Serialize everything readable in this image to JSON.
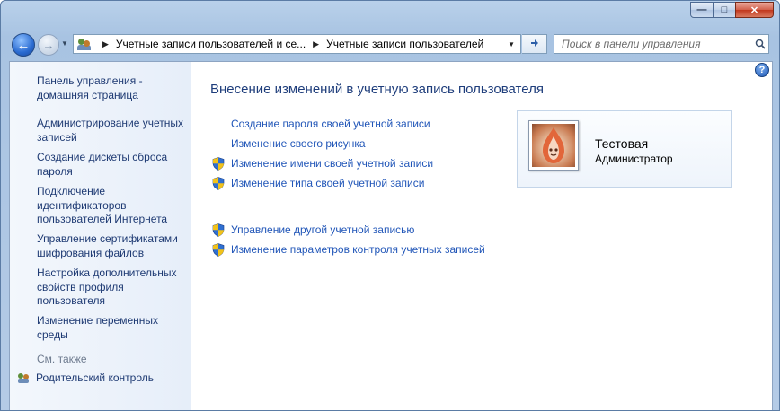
{
  "window": {
    "controls": {
      "minimize": "—",
      "maximize": "□",
      "close": "✕"
    }
  },
  "nav": {
    "back_icon": "back-arrow-icon",
    "forward_icon": "forward-arrow-icon",
    "breadcrumb": [
      "Учетные записи пользователей и се...",
      "Учетные записи пользователей"
    ],
    "search_placeholder": "Поиск в панели управления"
  },
  "sidebar": {
    "items": [
      {
        "label": "Панель управления - домашняя страница"
      },
      {
        "label": "Администрирование учетных записей"
      },
      {
        "label": "Создание дискеты сброса пароля"
      },
      {
        "label": "Подключение идентификаторов пользователей Интернета"
      },
      {
        "label": "Управление сертификатами шифрования файлов"
      },
      {
        "label": "Настройка дополнительных свойств профиля пользователя"
      },
      {
        "label": "Изменение переменных среды"
      }
    ],
    "see_also": "См. также",
    "parental_control": "Родительский контроль"
  },
  "main": {
    "title": "Внесение изменений в учетную запись пользователя",
    "tasks": [
      {
        "label": "Создание пароля своей учетной записи",
        "shield": false
      },
      {
        "label": "Изменение своего рисунка",
        "shield": false
      },
      {
        "label": "Изменение имени своей учетной записи",
        "shield": true
      },
      {
        "label": "Изменение типа своей учетной записи",
        "shield": true
      }
    ],
    "other_tasks": [
      {
        "label": "Управление другой учетной записью",
        "shield": true
      },
      {
        "label": "Изменение параметров контроля учетных записей",
        "shield": true
      }
    ]
  },
  "account": {
    "name": "Тестовая",
    "role": "Администратор"
  },
  "colors": {
    "link": "#2156b8",
    "sidebar_link": "#1e3a73",
    "title": "#1e3d7b",
    "shield_blue": "#2f6fd1",
    "shield_yellow": "#f2c21a"
  }
}
